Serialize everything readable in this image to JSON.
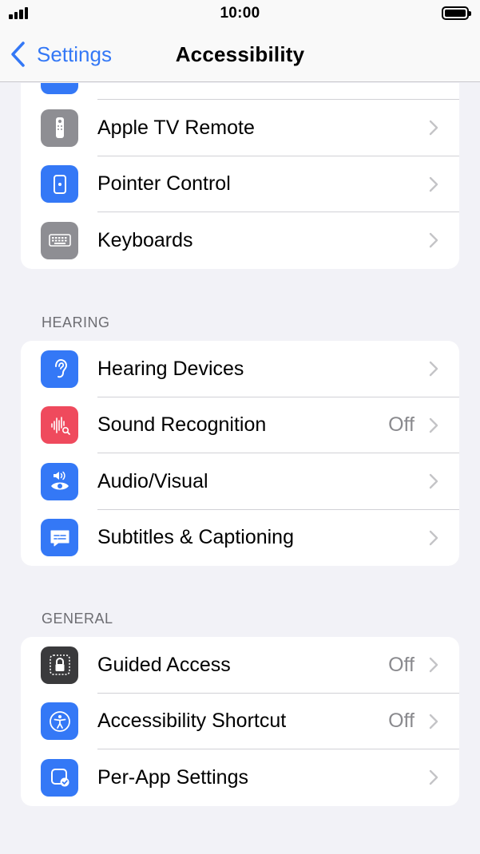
{
  "status_bar": {
    "time": "10:00"
  },
  "nav": {
    "back_label": "Settings",
    "title": "Accessibility"
  },
  "colors": {
    "accent": "#3478f6",
    "gray_icon": "#8e8e93",
    "blue_icon": "#3478f6",
    "red_icon": "#ef4a5d",
    "dark_icon": "#3a3a3c"
  },
  "sections": {
    "interaction_partial": {
      "items": [
        {
          "label": "Apple TV Remote",
          "icon": "apple-tv-remote-icon"
        },
        {
          "label": "Pointer Control",
          "icon": "pointer-control-icon"
        },
        {
          "label": "Keyboards",
          "icon": "keyboard-icon"
        }
      ]
    },
    "hearing": {
      "header": "HEARING",
      "items": [
        {
          "label": "Hearing Devices",
          "icon": "ear-icon"
        },
        {
          "label": "Sound Recognition",
          "value": "Off",
          "icon": "sound-recognition-icon"
        },
        {
          "label": "Audio/Visual",
          "icon": "audio-visual-icon"
        },
        {
          "label": "Subtitles & Captioning",
          "icon": "subtitles-icon"
        }
      ]
    },
    "general": {
      "header": "GENERAL",
      "items": [
        {
          "label": "Guided Access",
          "value": "Off",
          "icon": "guided-access-lock-icon"
        },
        {
          "label": "Accessibility Shortcut",
          "value": "Off",
          "icon": "accessibility-shortcut-icon"
        },
        {
          "label": "Per-App Settings",
          "icon": "per-app-settings-icon"
        }
      ]
    }
  }
}
